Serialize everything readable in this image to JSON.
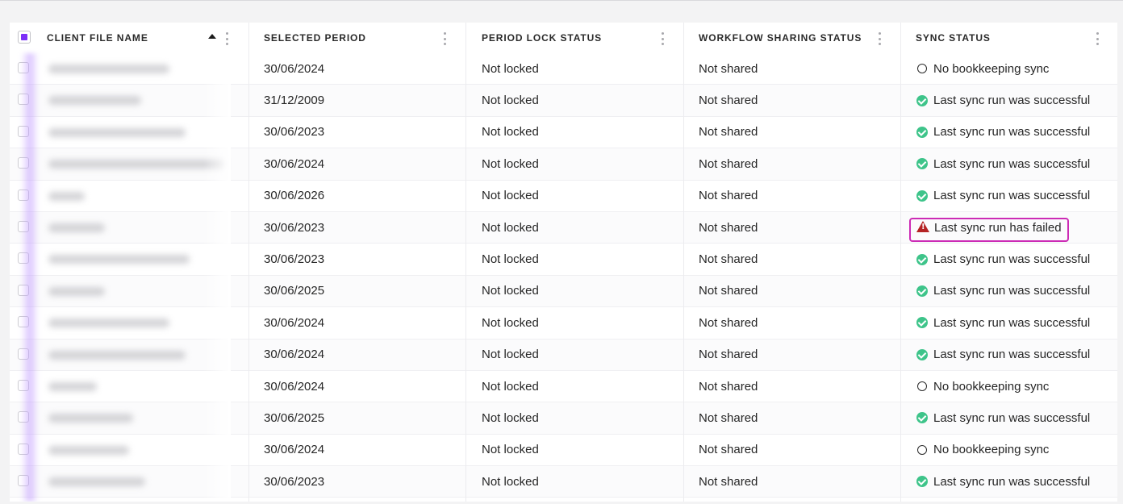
{
  "columns": [
    {
      "id": "name",
      "label": "CLIENT FILE NAME"
    },
    {
      "id": "period",
      "label": "SELECTED PERIOD"
    },
    {
      "id": "lock",
      "label": "PERIOD LOCK STATUS"
    },
    {
      "id": "share",
      "label": "WORKFLOW SHARING STATUS"
    },
    {
      "id": "sync",
      "label": "SYNC STATUS"
    }
  ],
  "sort": {
    "column": "name",
    "direction": "ascending"
  },
  "colors": {
    "accent": "#7b2ff7",
    "success": "#3ec48a",
    "error": "#b42323",
    "highlight": "#cc2bb5"
  },
  "rows": [
    {
      "period": "30/06/2024",
      "lock": "Not locked",
      "share": "Not shared",
      "sync": "No bookkeeping sync",
      "sync_icon": "circle-outline-icon"
    },
    {
      "period": "31/12/2009",
      "lock": "Not locked",
      "share": "Not shared",
      "sync": "Last sync run was successful",
      "sync_icon": "check-circle-icon"
    },
    {
      "period": "30/06/2023",
      "lock": "Not locked",
      "share": "Not shared",
      "sync": "Last sync run was successful",
      "sync_icon": "check-circle-icon"
    },
    {
      "period": "30/06/2024",
      "lock": "Not locked",
      "share": "Not shared",
      "sync": "Last sync run was successful",
      "sync_icon": "check-circle-icon"
    },
    {
      "period": "30/06/2026",
      "lock": "Not locked",
      "share": "Not shared",
      "sync": "Last sync run was successful",
      "sync_icon": "check-circle-icon"
    },
    {
      "period": "30/06/2023",
      "lock": "Not locked",
      "share": "Not shared",
      "sync": "Last sync run has failed",
      "sync_icon": "warning-triangle-icon"
    },
    {
      "period": "30/06/2023",
      "lock": "Not locked",
      "share": "Not shared",
      "sync": "Last sync run was successful",
      "sync_icon": "check-circle-icon"
    },
    {
      "period": "30/06/2025",
      "lock": "Not locked",
      "share": "Not shared",
      "sync": "Last sync run was successful",
      "sync_icon": "check-circle-icon"
    },
    {
      "period": "30/06/2024",
      "lock": "Not locked",
      "share": "Not shared",
      "sync": "Last sync run was successful",
      "sync_icon": "check-circle-icon"
    },
    {
      "period": "30/06/2024",
      "lock": "Not locked",
      "share": "Not shared",
      "sync": "Last sync run was successful",
      "sync_icon": "check-circle-icon"
    },
    {
      "period": "30/06/2024",
      "lock": "Not locked",
      "share": "Not shared",
      "sync": "No bookkeeping sync",
      "sync_icon": "circle-outline-icon"
    },
    {
      "period": "30/06/2025",
      "lock": "Not locked",
      "share": "Not shared",
      "sync": "Last sync run was successful",
      "sync_icon": "check-circle-icon"
    },
    {
      "period": "30/06/2024",
      "lock": "Not locked",
      "share": "Not shared",
      "sync": "No bookkeeping sync",
      "sync_icon": "circle-outline-icon"
    },
    {
      "period": "30/06/2023",
      "lock": "Not locked",
      "share": "Not shared",
      "sync": "Last sync run was successful",
      "sync_icon": "check-circle-icon"
    }
  ]
}
